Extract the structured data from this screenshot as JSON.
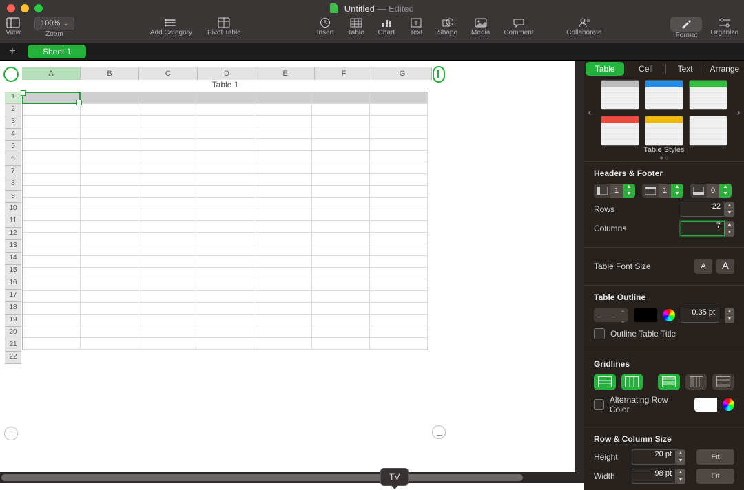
{
  "title": {
    "doc": "Untitled",
    "sep": " — ",
    "status": "Edited"
  },
  "toolbar": {
    "zoom": "100%",
    "view": "View",
    "zoom_l": "Zoom",
    "addcat": "Add Category",
    "pivot": "Pivot Table",
    "insert": "Insert",
    "table": "Table",
    "chart": "Chart",
    "text": "Text",
    "shape": "Shape",
    "media": "Media",
    "comment": "Comment",
    "collab": "Collaborate",
    "format": "Format",
    "organize": "Organize"
  },
  "sheet": {
    "tab": "Sheet 1",
    "table_title": "Table 1"
  },
  "cols": [
    "A",
    "B",
    "C",
    "D",
    "E",
    "F",
    "G"
  ],
  "rows": [
    "1",
    "2",
    "3",
    "4",
    "5",
    "6",
    "7",
    "8",
    "9",
    "10",
    "11",
    "12",
    "13",
    "14",
    "15",
    "16",
    "17",
    "18",
    "19",
    "20",
    "21",
    "22"
  ],
  "tip": "TV",
  "inspector": {
    "tabs": {
      "table": "Table",
      "cell": "Cell",
      "text": "Text",
      "arrange": "Arrange"
    },
    "styles_label": "Table Styles",
    "headers": {
      "title": "Headers & Footer",
      "col": "1",
      "row": "1",
      "footer": "0"
    },
    "size": {
      "rows_l": "Rows",
      "rows_v": "22",
      "cols_l": "Columns",
      "cols_v": "7"
    },
    "font": {
      "label": "Table Font Size"
    },
    "outline": {
      "label": "Table Outline",
      "pt": "0.35 pt",
      "title_cb": "Outline Table Title"
    },
    "grid": {
      "label": "Gridlines"
    },
    "alt": {
      "label": "Alternating Row Color"
    },
    "rc": {
      "title": "Row & Column Size",
      "h": "Height",
      "hv": "20 pt",
      "w": "Width",
      "wv": "98 pt",
      "fit": "Fit"
    }
  }
}
